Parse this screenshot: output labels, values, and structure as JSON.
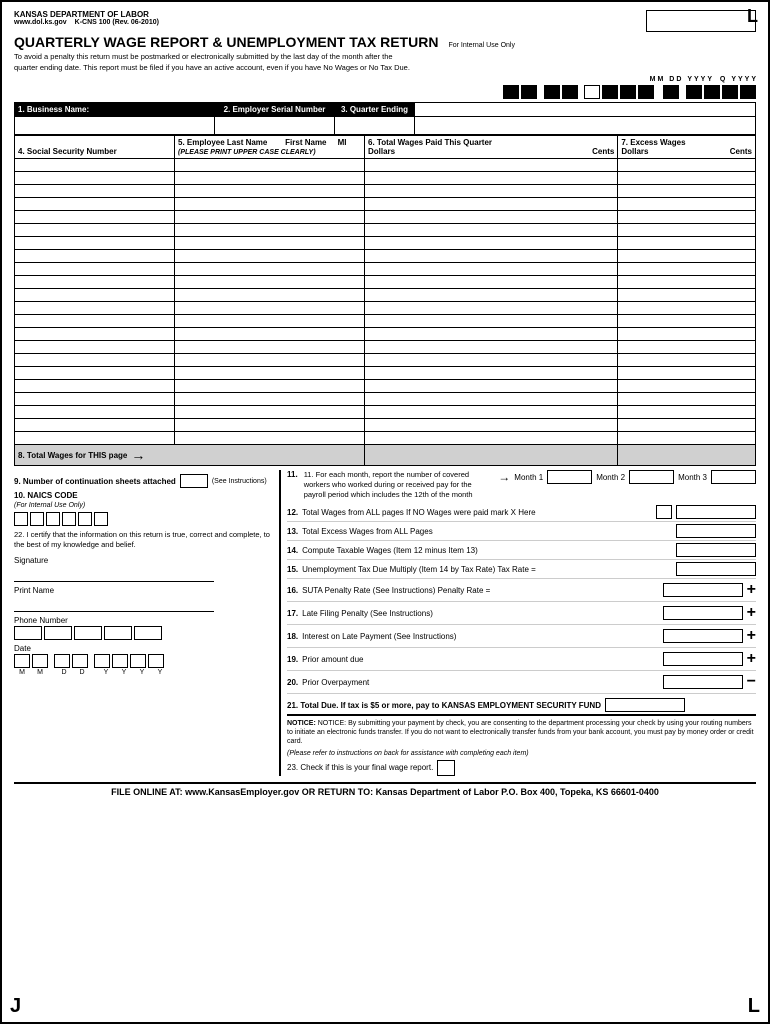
{
  "page": {
    "agency": "KANSAS DEPARTMENT OF LABOR",
    "website": "www.dol.ks.gov",
    "form_number": "K-CNS 100  (Rev. 06-2010)",
    "corner_top_right": "L",
    "corner_bottom_left": "J",
    "corner_bottom_right": "L",
    "title": "QUARTERLY WAGE REPORT & UNEMPLOYMENT TAX RETURN",
    "internal_use_only": "For Internal Use Only",
    "subtitle_line1": "To avoid a penalty this return must be postmarked or electronically submitted by the last day of the month after the",
    "subtitle_line2": "quarter ending date.  This report must be filed if you have an active account, even if you have No Wages or No Tax Due.",
    "date_labels": [
      "M",
      "M",
      "D",
      "D",
      "Y",
      "Y",
      "Y",
      "Y",
      "Q",
      "Y",
      "Y",
      "Y",
      "Y"
    ],
    "fields": {
      "business_name_label": "1. Business Name:",
      "employer_serial_label": "2. Employer Serial Number",
      "quarter_ending_label": "3. Quarter Ending",
      "ssn_label": "4. Social Security Number",
      "employee_last_name_label": "5. Employee Last Name",
      "first_name_label": "First Name",
      "mi_label": "MI",
      "print_note": "(PLEASE PRINT UPPER CASE CLEARLY)",
      "total_wages_label": "6. Total Wages Paid This Quarter",
      "dollars_label": "Dollars",
      "cents_label": "Cents",
      "excess_wages_label": "7. Excess Wages",
      "excess_dollars_label": "Dollars",
      "excess_cents_label": "Cents"
    },
    "total_wages_this_page": "8. Total Wages for THIS page",
    "bottom": {
      "num_continuation_label": "9. Number of continuation sheets attached",
      "see_instructions": "(See Instructions)",
      "naics_label": "10. NAICS CODE",
      "for_internal": "(For Internal Use Only)",
      "certify_label": "22. I certify that the information on this return is true, correct and complete, to the best of my knowledge and belief.",
      "signature_label": "Signature",
      "print_name_label": "Print Name",
      "phone_label": "Phone Number",
      "date_label": "Date",
      "date_sub_labels": [
        "M",
        "M",
        "D",
        "D",
        "Y",
        "Y",
        "Y",
        "Y"
      ],
      "month_instruction": "11. For each month, report the number of covered workers who worked during or received pay for the payroll period which includes the 12th of the month",
      "month1_label": "Month 1",
      "month2_label": "Month 2",
      "month3_label": "Month 3",
      "lines": [
        {
          "num": "12.",
          "label": "Total Wages from ALL pages  If NO Wages were paid mark X Here",
          "has_checkbox": true,
          "symbol": ""
        },
        {
          "num": "13.",
          "label": "Total Excess Wages from ALL Pages",
          "has_checkbox": false,
          "symbol": ""
        },
        {
          "num": "14.",
          "label": "Compute Taxable Wages  (Item 12 minus Item 13)",
          "has_checkbox": false,
          "symbol": ""
        },
        {
          "num": "15.",
          "label": "Unemployment Tax Due  Multiply  (Item 14  by Tax Rate)  Tax Rate =",
          "has_checkbox": false,
          "symbol": ""
        },
        {
          "num": "16.",
          "label": "SUTA Penalty Rate (See Instructions)    Penalty Rate =",
          "has_checkbox": false,
          "symbol": "+"
        },
        {
          "num": "17.",
          "label": "Late Filing Penalty  (See Instructions)",
          "has_checkbox": false,
          "symbol": "+"
        },
        {
          "num": "18.",
          "label": "Interest on Late Payment  (See Instructions)",
          "has_checkbox": false,
          "symbol": "+"
        },
        {
          "num": "19.",
          "label": "Prior amount due",
          "has_checkbox": false,
          "symbol": "+"
        },
        {
          "num": "20.",
          "label": "Prior Overpayment",
          "has_checkbox": false,
          "symbol": "−"
        }
      ],
      "total_due_line": "21. Total Due.  If tax is $5 or more, pay to KANSAS EMPLOYMENT SECURITY FUND",
      "notice": "NOTICE: By submitting your payment by check, you are consenting to the department processing your check by using your routing numbers to initiate an electronic funds transfer. If you do not want to electronically transfer funds from your bank account, you must pay by money order or credit card.",
      "please_refer": "(Please refer to instructions on back for assistance with completing each item)",
      "check_final_label": "23. Check if this is your final wage report.",
      "footer": "FILE ONLINE AT: www.KansasEmployer.gov   OR  RETURN TO: Kansas Department of Labor P.O. Box 400, Topeka, KS  66601-0400"
    }
  }
}
